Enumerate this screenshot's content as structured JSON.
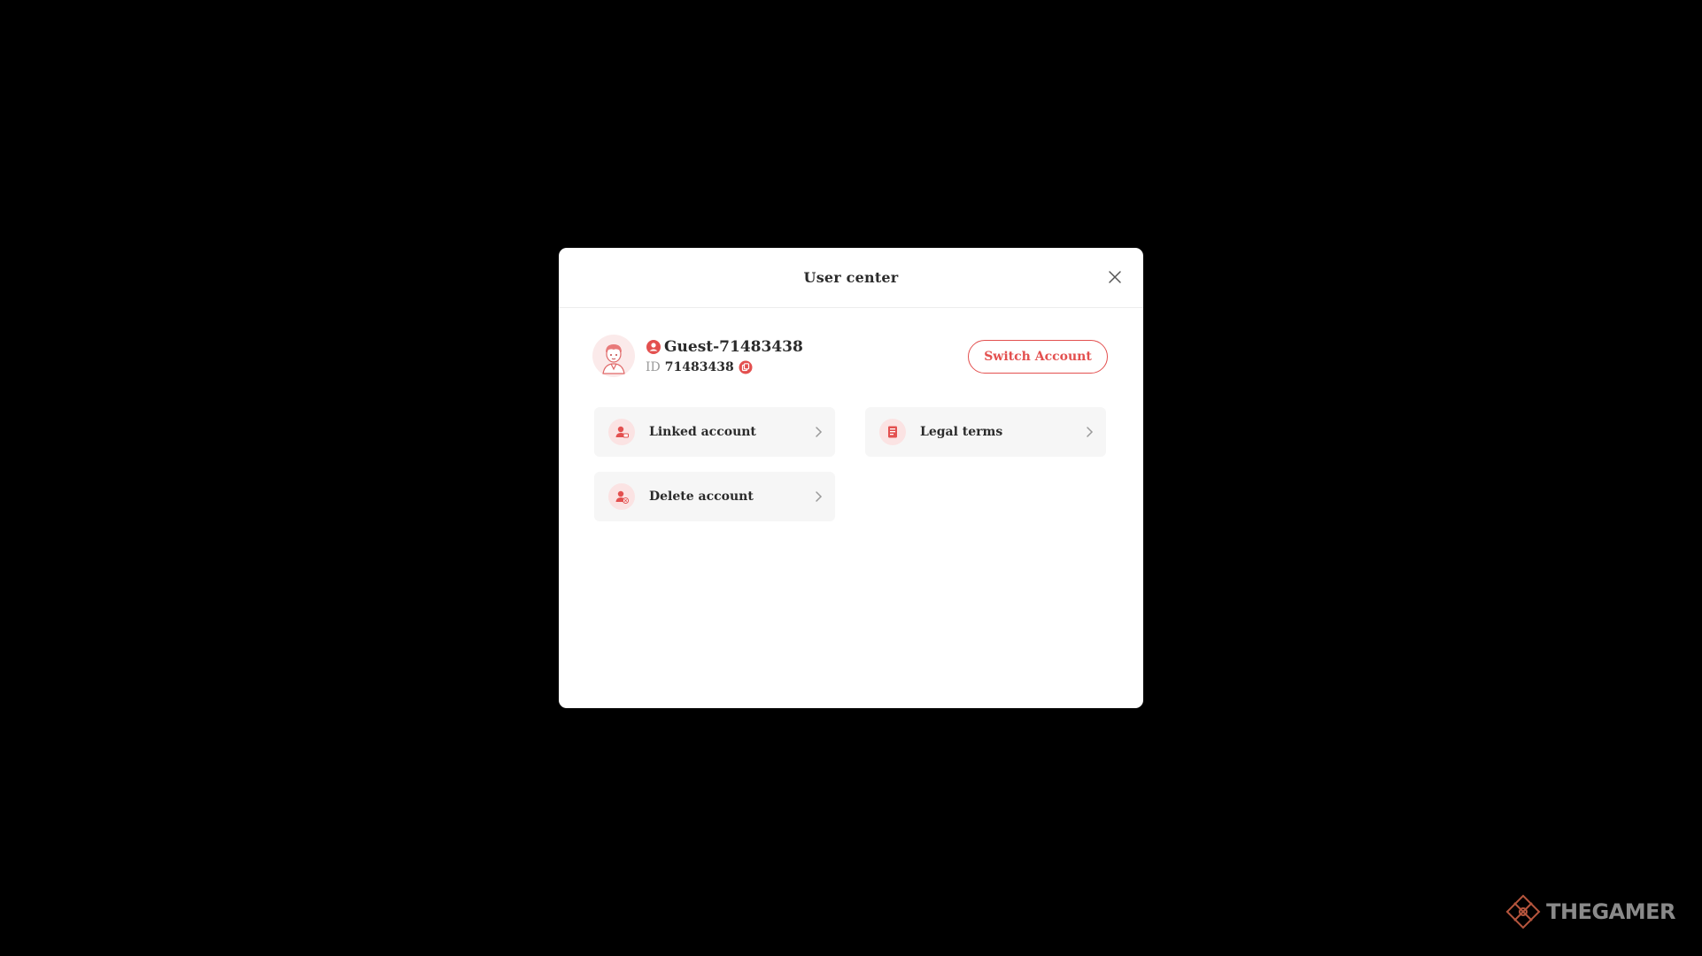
{
  "modal": {
    "title": "User center"
  },
  "profile": {
    "name": "Guest-71483438",
    "id_label": "ID",
    "id_value": "71483438"
  },
  "switch_button": "Switch Account",
  "menu": [
    {
      "label": "Linked account",
      "icon": "linked-account-icon"
    },
    {
      "label": "Legal terms",
      "icon": "legal-terms-icon"
    },
    {
      "label": "Delete account",
      "icon": "delete-account-icon"
    }
  ],
  "watermark": {
    "text": "THEGAMER"
  },
  "colors": {
    "accent": "#e3504f",
    "background": "#000000",
    "modal": "#ffffff",
    "menu_bg": "#f6f6f6"
  }
}
